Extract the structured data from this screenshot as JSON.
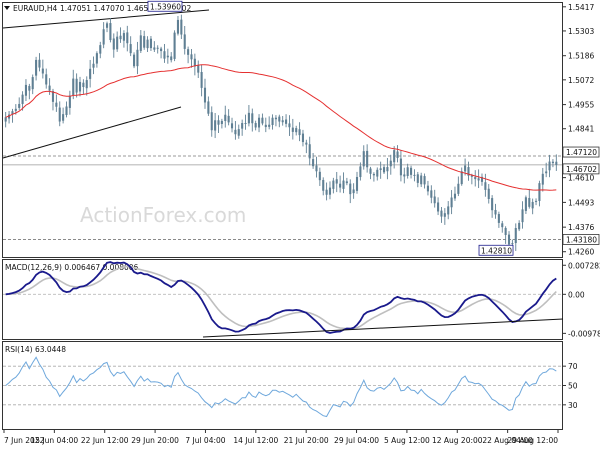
{
  "header": {
    "symbol": "EURAUD,H4",
    "quote": "1.47051 1.47070 1.46515 1.46702"
  },
  "watermark": "ActionForex.com",
  "colors": {
    "candle": "#5f7f93",
    "ma": "#e53030",
    "macd": "#1a1a8c",
    "signal": "#bfbfbf",
    "rsi": "#6fa8dc",
    "trendline": "#111111",
    "grid_dash": "#7a7a7a",
    "bg": "#ffffff",
    "watermark": "#d9d9d9"
  },
  "chart_data": [
    {
      "type": "candlestick",
      "name": "price",
      "x_ticks": [
        "7 Jun 2022",
        "15 Jun 04:00",
        "22 Jun 12:00",
        "29 Jun 20:00",
        "7 Jul 04:00",
        "14 Jul 12:00",
        "21 Jul 20:00",
        "29 Jul 04:00",
        "5 Aug 12:00",
        "12 Aug 20:00",
        "22 Aug 04:00",
        "29 Aug 12:00"
      ],
      "y_ticks": [
        1.5417,
        1.5303,
        1.5186,
        1.5072,
        1.4955,
        1.4841,
        1.4725,
        1.461,
        1.4493,
        1.4376,
        1.426
      ],
      "ylim": [
        1.4235,
        1.5435
      ],
      "closes": [
        1.4895,
        1.4908,
        1.4924,
        1.4935,
        1.4958,
        1.5002,
        1.5048,
        1.5021,
        1.5085,
        1.5166,
        1.513,
        1.5102,
        1.505,
        1.5021,
        1.4968,
        1.4945,
        1.4875,
        1.491,
        1.4946,
        1.4998,
        1.5078,
        1.5012,
        1.5062,
        1.5038,
        1.5071,
        1.5124,
        1.5148,
        1.5198,
        1.5236,
        1.5311,
        1.5339,
        1.526,
        1.5215,
        1.5276,
        1.5264,
        1.5293,
        1.5245,
        1.5198,
        1.5136,
        1.5214,
        1.5282,
        1.5224,
        1.5262,
        1.5222,
        1.5225,
        1.5221,
        1.5208,
        1.5172,
        1.5186,
        1.5165,
        1.5295,
        1.5355,
        1.5286,
        1.5218,
        1.519,
        1.5169,
        1.5135,
        1.5106,
        1.5034,
        1.4965,
        1.4912,
        1.4834,
        1.4881,
        1.486,
        1.4878,
        1.4907,
        1.4871,
        1.4843,
        1.4815,
        1.4839,
        1.4868,
        1.4868,
        1.4916,
        1.4867,
        1.4847,
        1.4893,
        1.4866,
        1.4849,
        1.486,
        1.4893,
        1.4893,
        1.4875,
        1.4881,
        1.4864,
        1.4848,
        1.4826,
        1.4844,
        1.4811,
        1.4778,
        1.4766,
        1.4701,
        1.4664,
        1.464,
        1.4598,
        1.4548,
        1.4529,
        1.4563,
        1.4596,
        1.4582,
        1.4563,
        1.4596,
        1.4584,
        1.4532,
        1.4554,
        1.4613,
        1.4663,
        1.4735,
        1.4659,
        1.4628,
        1.4621,
        1.4647,
        1.4654,
        1.4635,
        1.466,
        1.469,
        1.474,
        1.4703,
        1.4621,
        1.4625,
        1.4659,
        1.4623,
        1.4619,
        1.4585,
        1.462,
        1.4578,
        1.4545,
        1.4515,
        1.4489,
        1.445,
        1.4426,
        1.4442,
        1.4474,
        1.4516,
        1.4534,
        1.4581,
        1.464,
        1.4667,
        1.4619,
        1.4614,
        1.4603,
        1.4607,
        1.459,
        1.4552,
        1.4509,
        1.4456,
        1.4436,
        1.4396,
        1.4376,
        1.4339,
        1.4294,
        1.4299,
        1.4372,
        1.4396,
        1.446,
        1.4517,
        1.4472,
        1.4495,
        1.45,
        1.4584,
        1.4628,
        1.4639,
        1.4686,
        1.4685,
        1.467
      ],
      "ma_series": "red moving average",
      "levels": [
        {
          "label": "1.47120",
          "value": 1.4712,
          "style": "dashed"
        },
        {
          "label": "1.46702",
          "value": 1.46702,
          "style": "solid"
        },
        {
          "label": "1.43180",
          "value": 1.4318,
          "style": "dashed"
        }
      ],
      "annotations": [
        {
          "label": "1.53960",
          "value": 1.5396
        },
        {
          "label": "1.42810",
          "value": 1.4281
        }
      ]
    },
    {
      "type": "line",
      "name": "MACD(12,26,9) 0.006467 0.008006",
      "y_ticks": [
        {
          "label": "0.007282",
          "value": 0.007282
        },
        {
          "label": "0.00",
          "value": 0
        },
        {
          "label": "-0.009787",
          "value": -0.009787
        }
      ],
      "ylim": [
        -0.0112,
        0.0086
      ]
    },
    {
      "type": "line",
      "name": "RSI(14) 63.0448",
      "y_ticks": [
        {
          "label": "70",
          "value": 70
        },
        {
          "label": "50",
          "value": 50
        },
        {
          "label": "30",
          "value": 30
        }
      ],
      "ylim": [
        5,
        95
      ]
    }
  ]
}
